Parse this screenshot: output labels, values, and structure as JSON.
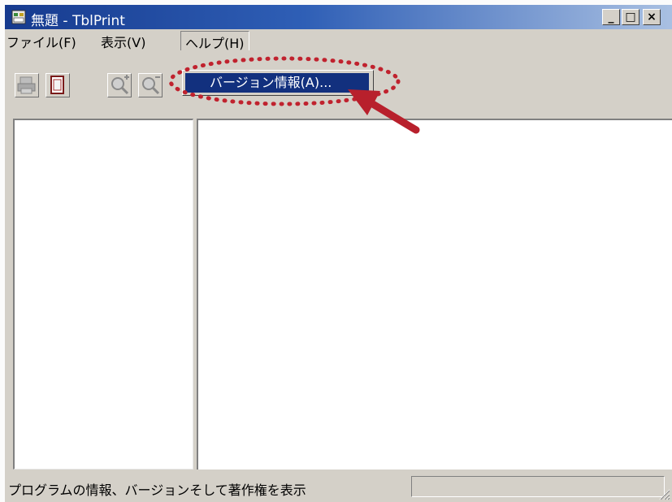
{
  "window": {
    "title": "無題 - TblPrint",
    "controls": {
      "minimize": "_",
      "maximize": "□",
      "close": "×"
    }
  },
  "menu": {
    "file": "ファイル(F)",
    "view": "表示(V)",
    "help": "ヘルプ(H)"
  },
  "help_menu": {
    "items": [
      "バージョン情報(A)..."
    ]
  },
  "toolbar": {
    "buttons": [
      "print-icon",
      "page-icon",
      "zoom-in-icon",
      "zoom-out-icon"
    ]
  },
  "statusbar": {
    "text": "プログラムの情報、バージョンそして著作権を表示",
    "panel": ""
  },
  "annotation": {
    "color": "#c0222e"
  }
}
